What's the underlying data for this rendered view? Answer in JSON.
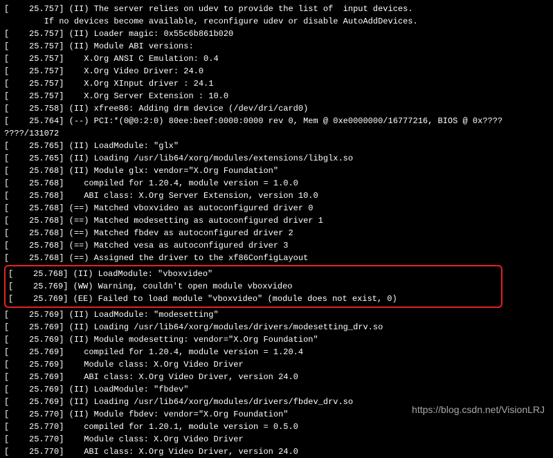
{
  "lines": [
    "[    25.757] (II) The server relies on udev to provide the list of  input devices.",
    "        If no devices become available, reconfigure udev or disable AutoAddDevices.",
    "[    25.757] (II) Loader magic: 0x55c6b861b020",
    "[    25.757] (II) Module ABI versions:",
    "[    25.757]    X.Org ANSI C Emulation: 0.4",
    "[    25.757]    X.Org Video Driver: 24.0",
    "[    25.757]    X.Org XInput driver : 24.1",
    "[    25.757]    X.Org Server Extension : 10.0",
    "[    25.758] (II) xfree86: Adding drm device (/dev/dri/card0)",
    "[    25.764] (--) PCI:*(0@0:2:0) 80ee:beef:0000:0000 rev 0, Mem @ 0xe0000000/16777216, BIOS @ 0x????",
    "????/131072",
    "[    25.765] (II) LoadModule: \"glx\"",
    "[    25.765] (II) Loading /usr/lib64/xorg/modules/extensions/libglx.so",
    "[    25.768] (II) Module glx: vendor=\"X.Org Foundation\"",
    "[    25.768]    compiled for 1.20.4, module version = 1.0.0",
    "[    25.768]    ABI class: X.Org Server Extension, version 10.0",
    "[    25.768] (==) Matched vboxvideo as autoconfigured driver 0",
    "[    25.768] (==) Matched modesetting as autoconfigured driver 1",
    "[    25.768] (==) Matched fbdev as autoconfigured driver 2",
    "[    25.768] (==) Matched vesa as autoconfigured driver 3",
    "[    25.768] (==) Assigned the driver to the xf86ConfigLayout"
  ],
  "highlighted": [
    "[    25.768] (II) LoadModule: \"vboxvideo\"",
    "[    25.769] (WW) Warning, couldn't open module vboxvideo",
    "[    25.769] (EE) Failed to load module \"vboxvideo\" (module does not exist, 0)"
  ],
  "lines_after": [
    "[    25.769] (II) LoadModule: \"modesetting\"",
    "[    25.769] (II) Loading /usr/lib64/xorg/modules/drivers/modesetting_drv.so",
    "[    25.769] (II) Module modesetting: vendor=\"X.Org Foundation\"",
    "[    25.769]    compiled for 1.20.4, module version = 1.20.4",
    "[    25.769]    Module class: X.Org Video Driver",
    "[    25.769]    ABI class: X.Org Video Driver, version 24.0",
    "[    25.769] (II) LoadModule: \"fbdev\"",
    "[    25.769] (II) Loading /usr/lib64/xorg/modules/drivers/fbdev_drv.so",
    "[    25.770] (II) Module fbdev: vendor=\"X.Org Foundation\"",
    "[    25.770]    compiled for 1.20.1, module version = 0.5.0",
    "[    25.770]    Module class: X.Org Video Driver",
    "[    25.770]    ABI class: X.Org Video Driver, version 24.0"
  ],
  "watermark": "https://blog.csdn.net/VisionLRJ"
}
